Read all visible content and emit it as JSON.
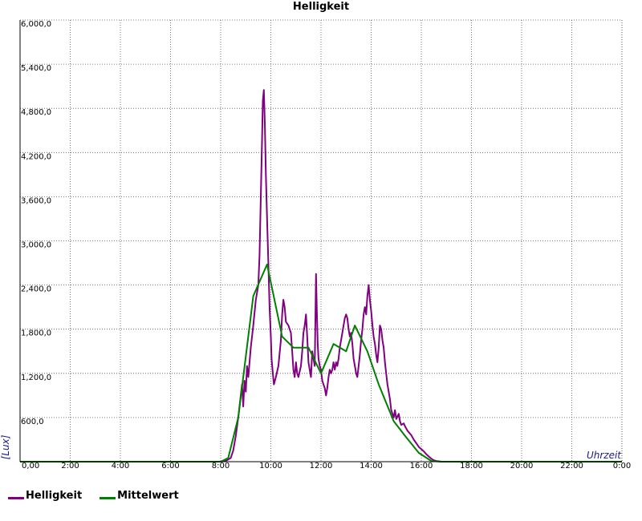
{
  "chart_data": {
    "type": "line",
    "title": "Helligkeit",
    "xlabel": "Uhrzeit",
    "ylabel": "[Lux]",
    "xlim": [
      0,
      24
    ],
    "ylim": [
      0,
      6000
    ],
    "grid": true,
    "legend_position": "bottom-left",
    "x_ticks": [
      {
        "value": 0,
        "label": "0,00"
      },
      {
        "value": 2,
        "label": "2:00"
      },
      {
        "value": 4,
        "label": "4:00"
      },
      {
        "value": 6,
        "label": "6:00"
      },
      {
        "value": 8,
        "label": "8:00"
      },
      {
        "value": 10,
        "label": "10:00"
      },
      {
        "value": 12,
        "label": "12:00"
      },
      {
        "value": 14,
        "label": "14:00"
      },
      {
        "value": 16,
        "label": "16:00"
      },
      {
        "value": 18,
        "label": "18:00"
      },
      {
        "value": 20,
        "label": "20:00"
      },
      {
        "value": 22,
        "label": "22:00"
      },
      {
        "value": 24,
        "label": "0:00"
      }
    ],
    "y_ticks": [
      {
        "value": 600,
        "label": "600,0"
      },
      {
        "value": 1200,
        "label": "1,200,0"
      },
      {
        "value": 1800,
        "label": "1,800,0"
      },
      {
        "value": 2400,
        "label": "2,400,0"
      },
      {
        "value": 3000,
        "label": "3,000,0"
      },
      {
        "value": 3600,
        "label": "3,600,0"
      },
      {
        "value": 4200,
        "label": "4,200,0"
      },
      {
        "value": 4800,
        "label": "4,800,0"
      },
      {
        "value": 5400,
        "label": "5,400,0"
      },
      {
        "value": 6000,
        "label": "6,000,0"
      }
    ],
    "series": [
      {
        "name": "Helligkeit",
        "color": "#800080",
        "points": [
          [
            0,
            0
          ],
          [
            8.0,
            0
          ],
          [
            8.2,
            10
          ],
          [
            8.4,
            50
          ],
          [
            8.5,
            150
          ],
          [
            8.6,
            350
          ],
          [
            8.7,
            600
          ],
          [
            8.8,
            900
          ],
          [
            8.85,
            1050
          ],
          [
            8.9,
            750
          ],
          [
            8.95,
            1100
          ],
          [
            9.0,
            950
          ],
          [
            9.05,
            1300
          ],
          [
            9.1,
            1150
          ],
          [
            9.2,
            1550
          ],
          [
            9.3,
            1850
          ],
          [
            9.4,
            2200
          ],
          [
            9.5,
            2400
          ],
          [
            9.55,
            2800
          ],
          [
            9.6,
            3600
          ],
          [
            9.65,
            4400
          ],
          [
            9.68,
            4900
          ],
          [
            9.72,
            5050
          ],
          [
            9.76,
            4600
          ],
          [
            9.8,
            3900
          ],
          [
            9.85,
            3300
          ],
          [
            9.9,
            2700
          ],
          [
            9.95,
            2100
          ],
          [
            10.0,
            1700
          ],
          [
            10.03,
            1400
          ],
          [
            10.08,
            1200
          ],
          [
            10.12,
            1050
          ],
          [
            10.2,
            1150
          ],
          [
            10.3,
            1300
          ],
          [
            10.4,
            1650
          ],
          [
            10.45,
            2000
          ],
          [
            10.5,
            2200
          ],
          [
            10.55,
            2100
          ],
          [
            10.6,
            1900
          ],
          [
            10.7,
            1850
          ],
          [
            10.8,
            1750
          ],
          [
            10.85,
            1500
          ],
          [
            10.9,
            1250
          ],
          [
            10.95,
            1150
          ],
          [
            11.0,
            1350
          ],
          [
            11.05,
            1200
          ],
          [
            11.1,
            1150
          ],
          [
            11.2,
            1300
          ],
          [
            11.25,
            1500
          ],
          [
            11.3,
            1750
          ],
          [
            11.35,
            1850
          ],
          [
            11.4,
            2000
          ],
          [
            11.45,
            1700
          ],
          [
            11.5,
            1350
          ],
          [
            11.55,
            1250
          ],
          [
            11.6,
            1150
          ],
          [
            11.65,
            1500
          ],
          [
            11.7,
            1400
          ],
          [
            11.75,
            1300
          ],
          [
            11.8,
            2550
          ],
          [
            11.83,
            2100
          ],
          [
            11.87,
            1600
          ],
          [
            11.9,
            1400
          ],
          [
            11.95,
            1300
          ],
          [
            12.0,
            1250
          ],
          [
            12.05,
            1100
          ],
          [
            12.1,
            1050
          ],
          [
            12.15,
            1000
          ],
          [
            12.2,
            900
          ],
          [
            12.25,
            1000
          ],
          [
            12.3,
            1150
          ],
          [
            12.35,
            1250
          ],
          [
            12.4,
            1200
          ],
          [
            12.45,
            1250
          ],
          [
            12.5,
            1350
          ],
          [
            12.55,
            1250
          ],
          [
            12.6,
            1350
          ],
          [
            12.65,
            1300
          ],
          [
            12.7,
            1400
          ],
          [
            12.75,
            1550
          ],
          [
            12.8,
            1650
          ],
          [
            12.85,
            1750
          ],
          [
            12.9,
            1850
          ],
          [
            12.95,
            1950
          ],
          [
            13.0,
            2000
          ],
          [
            13.05,
            1950
          ],
          [
            13.1,
            1800
          ],
          [
            13.15,
            1700
          ],
          [
            13.2,
            1750
          ],
          [
            13.25,
            1600
          ],
          [
            13.3,
            1400
          ],
          [
            13.35,
            1300
          ],
          [
            13.4,
            1200
          ],
          [
            13.45,
            1150
          ],
          [
            13.5,
            1300
          ],
          [
            13.55,
            1450
          ],
          [
            13.6,
            1650
          ],
          [
            13.65,
            1800
          ],
          [
            13.7,
            2000
          ],
          [
            13.75,
            2100
          ],
          [
            13.8,
            2000
          ],
          [
            13.85,
            2250
          ],
          [
            13.9,
            2400
          ],
          [
            13.95,
            2200
          ],
          [
            14.0,
            2050
          ],
          [
            14.05,
            1850
          ],
          [
            14.1,
            1700
          ],
          [
            14.15,
            1600
          ],
          [
            14.2,
            1450
          ],
          [
            14.25,
            1350
          ],
          [
            14.3,
            1550
          ],
          [
            14.35,
            1850
          ],
          [
            14.4,
            1800
          ],
          [
            14.45,
            1650
          ],
          [
            14.5,
            1550
          ],
          [
            14.55,
            1350
          ],
          [
            14.6,
            1200
          ],
          [
            14.65,
            1050
          ],
          [
            14.7,
            950
          ],
          [
            14.75,
            850
          ],
          [
            14.8,
            700
          ],
          [
            14.85,
            650
          ],
          [
            14.9,
            600
          ],
          [
            14.95,
            700
          ],
          [
            15.0,
            580
          ],
          [
            15.1,
            650
          ],
          [
            15.15,
            550
          ],
          [
            15.2,
            500
          ],
          [
            15.3,
            520
          ],
          [
            15.35,
            480
          ],
          [
            15.4,
            450
          ],
          [
            15.45,
            420
          ],
          [
            15.5,
            400
          ],
          [
            15.6,
            360
          ],
          [
            15.7,
            300
          ],
          [
            15.8,
            250
          ],
          [
            15.9,
            200
          ],
          [
            16.0,
            170
          ],
          [
            16.1,
            140
          ],
          [
            16.2,
            100
          ],
          [
            16.3,
            70
          ],
          [
            16.4,
            40
          ],
          [
            16.5,
            20
          ],
          [
            16.6,
            10
          ],
          [
            16.8,
            0
          ],
          [
            23.6,
            0
          ]
        ]
      },
      {
        "name": "Mittelwert",
        "color": "#008000",
        "points": [
          [
            0,
            0
          ],
          [
            8.0,
            0
          ],
          [
            8.3,
            50
          ],
          [
            8.7,
            600
          ],
          [
            9.3,
            2250
          ],
          [
            9.85,
            2680
          ],
          [
            10.45,
            1700
          ],
          [
            10.9,
            1550
          ],
          [
            11.5,
            1550
          ],
          [
            12.0,
            1200
          ],
          [
            12.5,
            1600
          ],
          [
            13.0,
            1500
          ],
          [
            13.35,
            1850
          ],
          [
            13.85,
            1500
          ],
          [
            14.3,
            1050
          ],
          [
            14.9,
            550
          ],
          [
            15.4,
            330
          ],
          [
            15.9,
            120
          ],
          [
            16.4,
            10
          ],
          [
            16.8,
            0
          ],
          [
            24,
            0
          ]
        ]
      }
    ]
  }
}
